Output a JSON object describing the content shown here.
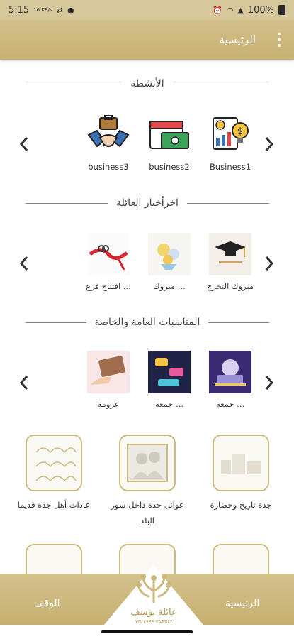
{
  "status": {
    "time": "5:15",
    "net_speed": "16 KB/s",
    "battery": "100%"
  },
  "appbar": {
    "title": "الرئيسية"
  },
  "sections": [
    {
      "title": "الأنشطة",
      "items": [
        {
          "caption": "Business1",
          "icon": "business-growth-icon"
        },
        {
          "caption": "business2",
          "icon": "calendar-money-icon"
        },
        {
          "caption": "business3",
          "icon": "handshake-icon"
        }
      ]
    },
    {
      "title": "اخرأخبار العائلة",
      "items": [
        {
          "caption": "مبروك التخرج",
          "icon": "graduation-cap-image"
        },
        {
          "caption": "مبروك ...",
          "icon": "flowers-image"
        },
        {
          "caption": "افتتاح فرع ...",
          "icon": "ribbon-cutting-image"
        }
      ]
    },
    {
      "title": "المناسبات العامة والخاصة",
      "items": [
        {
          "caption": "جمعة ...",
          "icon": "laptop-gathering-image"
        },
        {
          "caption": "جمعة ...",
          "icon": "eid-mubarak-image"
        },
        {
          "caption": "عزومة",
          "icon": "invitation-card-image"
        }
      ]
    }
  ],
  "tiles": [
    {
      "caption": "جدة تاريخ وحضارة",
      "icon": "city-buildings-icon"
    },
    {
      "caption": "عوائل جدة داخل سور البلد",
      "icon": "family-portrait-icon"
    },
    {
      "caption": "عادات أهل جدة قديما",
      "icon": "arabesque-pattern-icon"
    }
  ],
  "bottom_nav": {
    "home": "الرئيسية",
    "waqf": "الوقف"
  },
  "logo": {
    "arabic": "عائلة يوسف",
    "latin": "YOUSEF FAMILY"
  },
  "colors": {
    "gold": "#cdb97f",
    "status": "#d7c89c"
  }
}
